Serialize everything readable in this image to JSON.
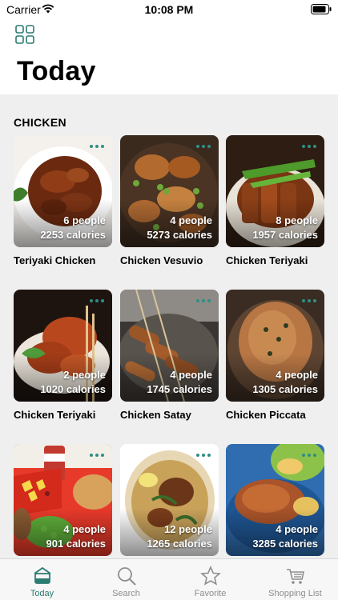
{
  "status": {
    "carrier": "Carrier",
    "time": "10:08 PM"
  },
  "header": {
    "title": "Today"
  },
  "section": {
    "title": "CHICKEN"
  },
  "recipes": [
    {
      "title": "Teriyaki Chicken",
      "people": "6 people",
      "calories": "2253 calories"
    },
    {
      "title": "Chicken Vesuvio",
      "people": "4 people",
      "calories": "5273 calories"
    },
    {
      "title": "Chicken Teriyaki",
      "people": "8 people",
      "calories": "1957 calories"
    },
    {
      "title": "Chicken Teriyaki",
      "people": "2 people",
      "calories": "1020 calories"
    },
    {
      "title": "Chicken Satay",
      "people": "4 people",
      "calories": "1745 calories"
    },
    {
      "title": "Chicken Piccata",
      "people": "4 people",
      "calories": "1305 calories"
    },
    {
      "title": "",
      "people": "4 people",
      "calories": "901 calories"
    },
    {
      "title": "",
      "people": "12 people",
      "calories": "1265 calories"
    },
    {
      "title": "",
      "people": "4 people",
      "calories": "3285 calories"
    }
  ],
  "tabs": [
    {
      "label": "Today",
      "icon": "home-icon",
      "active": true
    },
    {
      "label": "Search",
      "icon": "search-icon",
      "active": false
    },
    {
      "label": "Favorite",
      "icon": "star-icon",
      "active": false
    },
    {
      "label": "Shopping List",
      "icon": "cart-icon",
      "active": false
    }
  ],
  "colors": {
    "accent": "#2b7c73",
    "dots": "#2f8f84",
    "background": "#efefef"
  }
}
